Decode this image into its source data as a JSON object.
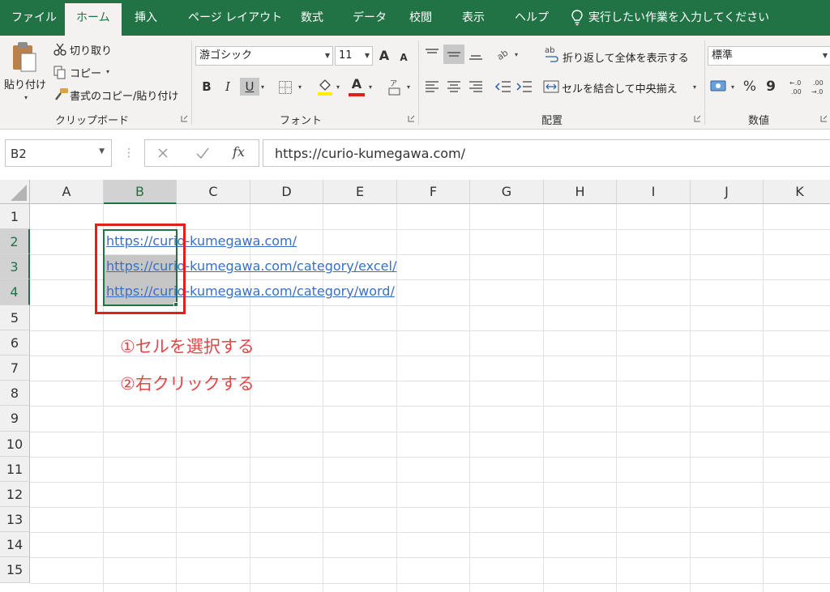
{
  "tabs": [
    {
      "label": "ファイル",
      "active": false
    },
    {
      "label": "ホーム",
      "active": true
    },
    {
      "label": "挿入",
      "active": false
    },
    {
      "label": "ページ レイアウト",
      "active": false
    },
    {
      "label": "数式",
      "active": false
    },
    {
      "label": "データ",
      "active": false
    },
    {
      "label": "校閲",
      "active": false
    },
    {
      "label": "表示",
      "active": false
    },
    {
      "label": "ヘルプ",
      "active": false
    }
  ],
  "tell_me": "実行したい作業を入力してください",
  "ribbon": {
    "clipboard": {
      "paste": "貼り付け",
      "cut": "切り取り",
      "copy": "コピー",
      "format_painter": "書式のコピー/貼り付け",
      "label": "クリップボード"
    },
    "font": {
      "name": "游ゴシック",
      "size": "11",
      "bold": "B",
      "italic": "I",
      "underline": "U",
      "grow": "A",
      "shrink": "A",
      "font_color": "A",
      "label": "フォント"
    },
    "alignment": {
      "wrap_text": "折り返して全体を表示する",
      "merge_center": "セルを結合して中央揃え",
      "label": "配置"
    },
    "number": {
      "format": "標準",
      "percent": "%",
      "comma": "9",
      "label": "数値"
    }
  },
  "formula_bar": {
    "name_box": "B2",
    "fx": "fx",
    "value": "https://curio-kumegawa.com/"
  },
  "grid": {
    "columns": [
      "A",
      "B",
      "C",
      "D",
      "E",
      "F",
      "G",
      "H",
      "I",
      "J",
      "K"
    ],
    "rows": [
      "1",
      "2",
      "3",
      "4",
      "5",
      "6",
      "7",
      "8",
      "9",
      "10",
      "11",
      "12",
      "13",
      "14",
      "15"
    ],
    "cells": {
      "B2": "https://curio-kumegawa.com/",
      "B3": "https://curio-kumegawa.com/category/excel/",
      "B4": "https://curio-kumegawa.com/category/word/"
    }
  },
  "annotations": {
    "step1": "①セルを選択する",
    "step2": "②右クリックする"
  },
  "colors": {
    "excel_green": "#217346",
    "link_blue": "#3a6fc4",
    "annotation_red": "#e04848",
    "highlight_box": "#e0201c"
  }
}
